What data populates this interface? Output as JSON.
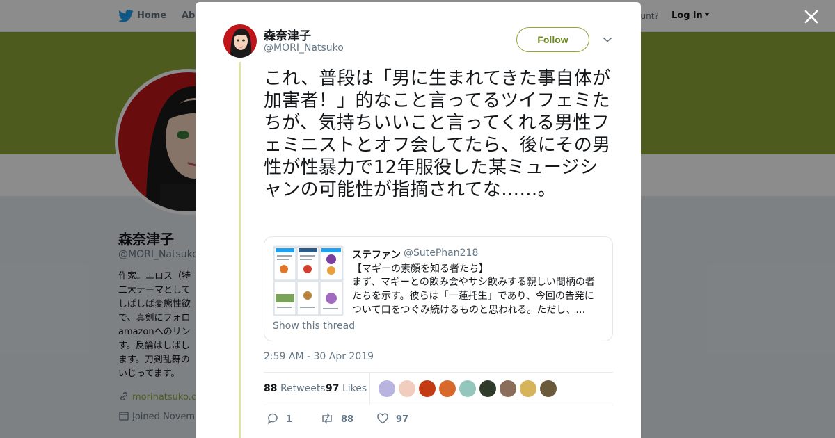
{
  "topnav": {
    "home_label": "Home",
    "about_label": "Abo",
    "have_account": "ccount?",
    "login_label": "Log in"
  },
  "profile": {
    "name": "森奈津子",
    "handle": "@MORI_Natsuko",
    "bio": "作家。エロス（特\n二大テーマとして\nしばしば変態性欲\nで、真剣にフォロ\namazonへのリン\nす。反論はしばし\nます。刀剣乱舞の\nいじってます。",
    "link": "morinatsuko.c",
    "joined": "Joined Novem"
  },
  "tweet": {
    "author_name": "森奈津子",
    "author_handle": "@MORI_Natsuko",
    "follow_label": "Follow",
    "text": "これ、普段は「男に生まれてきた事自体が加害者！」的なこと言ってるツイフェミたちが、気持ちいいこと言ってくれる男性フェミニストとオフ会してたら、後にその男性が性暴力で12年服役した某ミュージシャンの可能性が指摘されてな……。",
    "timestamp": "2:59 AM - 30 Apr 2019",
    "retweets_count": "88",
    "retweets_label": "Retweets",
    "likes_count": "97",
    "likes_label": "Likes",
    "reply_count": "1",
    "retweet_count": "88",
    "like_count": "97"
  },
  "quote": {
    "name": "ステファン",
    "handle": "@SutePhan218",
    "title": "【マギーの素顔を知る者たち】",
    "body": "まず、マギーとの飲み会やサシ飲みする親しい間柄の者たちを示す。彼らは「一蓮托生」であり、今回の告発について口をつぐみ続けるものと思われる。ただし、…",
    "show_thread": "Show this thread"
  },
  "colors": {
    "accent": "#8ea73a",
    "banner": "#8ea73a",
    "thread_line": "#dde3a6",
    "twitter_blue": "#1da1f2"
  }
}
